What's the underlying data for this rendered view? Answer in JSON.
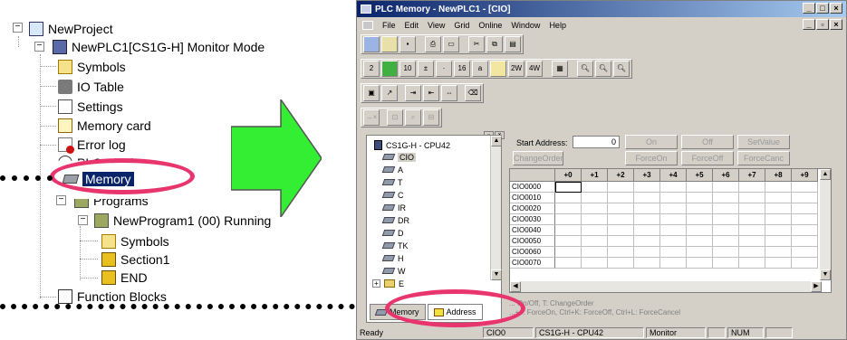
{
  "project_tree": {
    "items": [
      {
        "label": "NewProject",
        "icon": "network-icon"
      },
      {
        "label": "NewPLC1[CS1G-H] Monitor Mode",
        "icon": "plc-icon"
      },
      {
        "label": "Symbols",
        "icon": "symbols-icon"
      },
      {
        "label": "IO Table",
        "icon": "io-table-icon"
      },
      {
        "label": "Settings",
        "icon": "settings-icon"
      },
      {
        "label": "Memory card",
        "icon": "memory-card-icon"
      },
      {
        "label": "Error log",
        "icon": "error-log-icon"
      },
      {
        "label": "PLC Clock",
        "icon": "clock-icon"
      },
      {
        "label": "Memory",
        "icon": "memory-chip-icon"
      },
      {
        "label": "Programs",
        "icon": "programs-icon"
      },
      {
        "label": "NewProgram1 (00) Running",
        "icon": "program-icon"
      },
      {
        "label": "Symbols",
        "icon": "symbols-icon"
      },
      {
        "label": "Section1",
        "icon": "section-icon"
      },
      {
        "label": "END",
        "icon": "end-section-icon"
      },
      {
        "label": "Function Blocks",
        "icon": "function-blocks-icon"
      }
    ]
  },
  "window": {
    "title": "PLC Memory - NewPLC1 - [CIO]",
    "menu": [
      "File",
      "Edit",
      "View",
      "Grid",
      "Online",
      "Window",
      "Help"
    ],
    "toolbar_row3": [
      "2",
      "10",
      "16",
      "a",
      "2W",
      "4W"
    ]
  },
  "memory_tree": {
    "root": "CS1G-H - CPU42",
    "areas": [
      "CIO",
      "A",
      "T",
      "C",
      "IR",
      "DR",
      "D",
      "TK",
      "H",
      "W",
      "E"
    ]
  },
  "tabs": {
    "memory": "Memory",
    "address": "Address"
  },
  "controls": {
    "start_address_label": "Start Address:",
    "start_address_value": "0",
    "on": "On",
    "off": "Off",
    "set_value": "SetValue",
    "change_order": "ChangeOrder",
    "force_on": "ForceOn",
    "force_off": "ForceOff",
    "force_cancel": "ForceCanc"
  },
  "grid": {
    "columns": [
      "+0",
      "+1",
      "+2",
      "+3",
      "+4",
      "+5",
      "+6",
      "+7",
      "+8",
      "+9"
    ],
    "rows": [
      "CIO0000",
      "CIO0010",
      "CIO0020",
      "CIO0030",
      "CIO0040",
      "CIO0050",
      "CIO0060",
      "CIO0070"
    ]
  },
  "hints": {
    "line1": "... On/Off,   T: ChangeOrder",
    "line2": "...+J: ForceOn,   Ctrl+K: ForceOff,   Ctrl+L: ForceCancel"
  },
  "statusbar": {
    "ready": "Ready",
    "area": "CIO0",
    "plc": "CS1G-H - CPU42",
    "mode": "Monitor",
    "num": "NUM"
  },
  "colors": {
    "highlight_ring": "#e8356e",
    "arrow": "#33ee33",
    "titlebar": "#0a246a"
  }
}
